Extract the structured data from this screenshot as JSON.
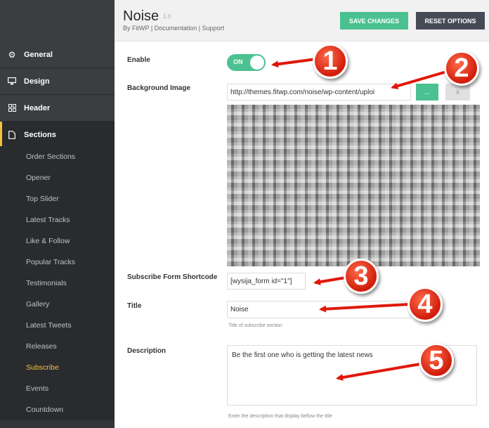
{
  "sidebar": {
    "items": [
      {
        "label": "General",
        "icon": "gear-icon"
      },
      {
        "label": "Design",
        "icon": "monitor-icon"
      },
      {
        "label": "Header",
        "icon": "grid-icon"
      },
      {
        "label": "Sections",
        "icon": "file-icon"
      }
    ],
    "sub_items": [
      "Order Sections",
      "Opener",
      "Top Slider",
      "Latest Tracks",
      "Like & Follow",
      "Popular Tracks",
      "Testimonials",
      "Gallery",
      "Latest Tweets",
      "Releases",
      "Subscribe",
      "Events",
      "Countdown"
    ]
  },
  "header": {
    "title": "Noise",
    "version": "1.0",
    "byline": "By FitWP | Documentation | Support",
    "save_label": "SAVE CHANGES",
    "reset_label": "RESET OPTIONS"
  },
  "form": {
    "enable_label": "Enable",
    "toggle_text": "ON",
    "bg_label": "Background Image",
    "bg_url": "http://themes.fitwp.com/noise/wp-content/uploi",
    "upload_label": "...",
    "remove_label": "x",
    "shortcode_label": "Subscribe Form Shortcode",
    "shortcode_value": "[wysija_form id=\"1\"]",
    "title_label": "Title",
    "title_value": "Noise",
    "title_help": "Title of subscribe section",
    "desc_label": "Description",
    "desc_value": "Be the first one who is getting the latest news",
    "desc_help": "Enter the description that display bellow the title"
  },
  "badges": [
    "1",
    "2",
    "3",
    "4",
    "5"
  ],
  "colors": {
    "accent": "#4bc191",
    "sidebar": "#323438",
    "highlight": "#f7c03c",
    "badge": "#d01c0a"
  }
}
